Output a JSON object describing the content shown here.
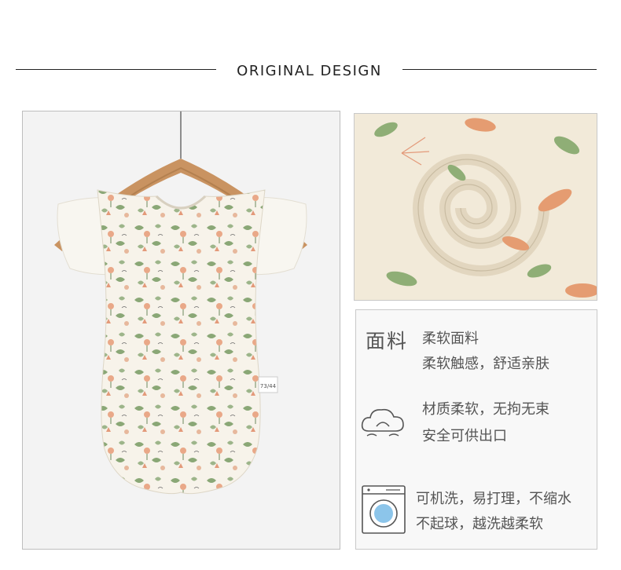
{
  "header": {
    "title": "ORIGINAL DESIGN"
  },
  "product": {
    "size_tag": "73/44"
  },
  "info": {
    "fabric_title": "面料",
    "fabric_line1": "柔软面料",
    "fabric_line2": "柔软触感，舒适亲肤",
    "feature1_line1": "材质柔软，无拘无束",
    "feature1_line2": "安全可供出口",
    "feature2_line1": "可机洗，易打理，不缩水",
    "feature2_line2": "不起球，越洗越柔软"
  },
  "icons": [
    "cloud-icon",
    "washing-machine-icon"
  ]
}
